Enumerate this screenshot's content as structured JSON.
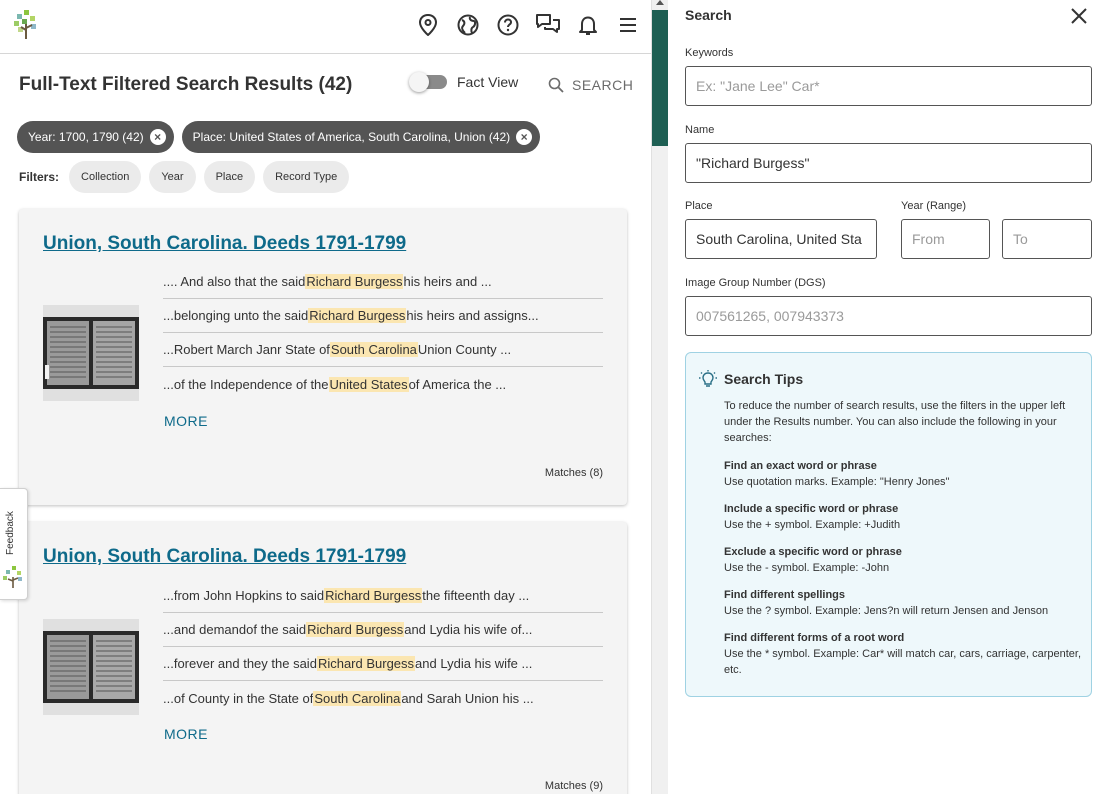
{
  "header": {
    "icons": [
      "location-pin-icon",
      "globe-icon",
      "help-icon",
      "chat-icon",
      "bell-icon",
      "menu-icon"
    ]
  },
  "results": {
    "title": "Full-Text Filtered Search Results (42)",
    "fact_view_label": "Fact View",
    "fact_view_on": false,
    "search_label": "SEARCH"
  },
  "active_filters": [
    {
      "label": "Year: 1700, 1790 (42)"
    },
    {
      "label": "Place: United States of America, South Carolina, Union (42)"
    }
  ],
  "filters": {
    "label": "Filters:",
    "options": [
      "Collection",
      "Year",
      "Place",
      "Record Type"
    ]
  },
  "cards": [
    {
      "title": "Union, South Carolina. Deeds 1791-1799",
      "snippets": [
        {
          "pre": ".... And also that the said ",
          "hl": "Richard Burgess",
          "post": " his heirs and ..."
        },
        {
          "pre": "...belonging unto the said ",
          "hl": "Richard Burgess",
          "post": " his heirs and assigns..."
        },
        {
          "pre": "...Robert March Janr State of ",
          "hl": "South Carolina",
          "post": " Union County ..."
        },
        {
          "pre": "...of the Independence of the ",
          "hl": "United States",
          "post": " of America the ..."
        }
      ],
      "more": "MORE",
      "matches": "Matches (8)"
    },
    {
      "title": "Union, South Carolina. Deeds 1791-1799",
      "snippets": [
        {
          "pre": "...from John Hopkins to said ",
          "hl": "Richard Burgess",
          "post": " the fifteenth day ..."
        },
        {
          "pre": "...and demandof the said ",
          "hl": "Richard Burgess",
          "post": " and Lydia his wife of..."
        },
        {
          "pre": "...forever and they the said ",
          "hl": "Richard Burgess",
          "post": " and Lydia his wife ..."
        },
        {
          "pre": "...of County in the State of ",
          "hl": "South Carolina",
          "post": " and Sarah Union his ..."
        }
      ],
      "more": "MORE",
      "matches": "Matches (9)"
    }
  ],
  "feedback": {
    "label": "Feedback"
  },
  "search_panel": {
    "title": "Search",
    "keywords": {
      "label": "Keywords",
      "value": "",
      "placeholder": "Ex: \"Jane Lee\" Car*"
    },
    "name": {
      "label": "Name",
      "value": "\"Richard Burgess\""
    },
    "place": {
      "label": "Place",
      "value": "South Carolina, United Sta"
    },
    "year_range": {
      "label": "Year (Range)",
      "from_placeholder": "From",
      "to_placeholder": "To"
    },
    "dgs": {
      "label": "Image Group Number (DGS)",
      "placeholder": "007561265, 007943373"
    }
  },
  "search_tips": {
    "title": "Search Tips",
    "intro": "To reduce the number of search results, use the filters in the upper left under the Results number. You can also include the following in your searches:",
    "tips": [
      {
        "head": "Find an exact word or phrase",
        "body": "Use quotation marks. Example: \"Henry Jones\""
      },
      {
        "head": "Include a specific word or phrase",
        "body": "Use the + symbol. Example: +Judith"
      },
      {
        "head": "Exclude a specific word or phrase",
        "body": "Use the - symbol. Example: -John"
      },
      {
        "head": "Find different spellings",
        "body": "Use the ? symbol. Example: Jens?n will return Jensen and Jenson"
      },
      {
        "head": "Find different forms of a root word",
        "body": "Use the * symbol. Example: Car* will match car, cars, carriage, carpenter, etc."
      }
    ]
  },
  "colors": {
    "link": "#0e6a8a",
    "highlight": "#fbe6b1",
    "chip_bg": "#545454",
    "scroll_thumb": "#1e5f53",
    "tips_border": "#9fd2e3"
  }
}
